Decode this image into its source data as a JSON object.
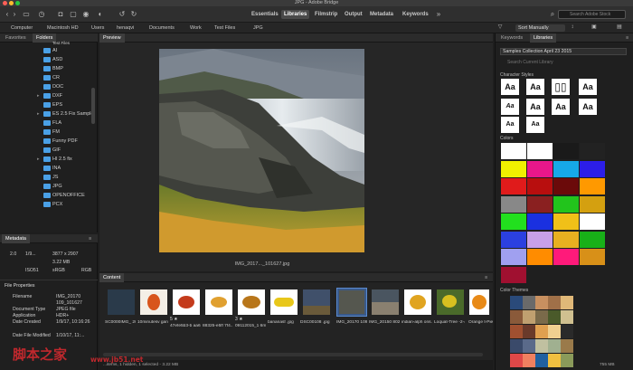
{
  "window": {
    "title": "JPG - Adobe Bridge"
  },
  "toolbar": {
    "workspaces": [
      "Essentials",
      "Libraries",
      "Filmstrip",
      "Output",
      "Metadata",
      "Keywords"
    ],
    "active_workspace": "Libraries",
    "stock_search_placeholder": "Search Adobe Stock"
  },
  "pathbar": {
    "crumbs": [
      "Computer",
      "Macintosh HD",
      "Users",
      "henaqvi",
      "Documents",
      "Work",
      "Test Files",
      "JPG"
    ],
    "sort": "Sort Manually"
  },
  "left_panel": {
    "tabs": [
      "Favorites",
      "Folders"
    ],
    "active_tab": "Folders",
    "folders": [
      "Test Files",
      "AI",
      "ASD",
      "BMP",
      "CR",
      "DOC",
      "DXF",
      "EPS",
      "ES 2.5 Fix Sample",
      "FLA",
      "FM",
      "Funny PDF",
      "GIF",
      "HI 2.5 fix",
      "INA",
      "JS",
      "JPG",
      "OPENOFFICE",
      "PCX"
    ]
  },
  "metadata": {
    "tab": "Metadata",
    "exposure": [
      "2.0",
      "1/9...",
      "3877 x 2907",
      "3.22 MB",
      "ISO51",
      "sRGB",
      "RGB"
    ],
    "section": "File Properties",
    "rows": [
      {
        "label": "Filename",
        "value": "IMG_20170 109_101627"
      },
      {
        "label": "Document Type",
        "value": "JPEG file"
      },
      {
        "label": "Application",
        "value": "HDR+"
      },
      {
        "label": "Date Created",
        "value": "1/9/17, 10:16:26"
      },
      {
        "label": "Date File Modified",
        "value": "1/10/17, 11:..."
      }
    ]
  },
  "preview": {
    "tab": "Preview",
    "filename": "IMG_2017..._101627.jpg"
  },
  "content": {
    "tab": "Content",
    "thumbs": [
      {
        "label": "SC0000IMG_ 2015_8..llR.jpg",
        "stars": "",
        "color": "#2a3a4a"
      },
      {
        "label": "10minutesv gan...81.jpg",
        "stars": "",
        "color": "#d8551c"
      },
      {
        "label": "47efe5b3-b aa6...89.jpg",
        "stars": "5 ★",
        "color": "#c43b1c"
      },
      {
        "label": "88325-e5ff 7f4...28.jpg",
        "stars": "",
        "color": "#e0a030"
      },
      {
        "label": "09112015_1 6mi...to.jpg",
        "stars": "3 ★",
        "color": "#b8761a"
      },
      {
        "label": "bananasf .jpg",
        "stars": "",
        "color": "#e8c71a"
      },
      {
        "label": "DSC00108 .jpg",
        "stars": "",
        "color": "#40506a"
      },
      {
        "label": "IMG_20170 109...27.jpg",
        "stars": "",
        "color": "#394a5c"
      },
      {
        "label": "IMG_20150 802...20.jpg",
        "stars": "",
        "color": "#4a5560"
      },
      {
        "label": "indian-alph ons...go.jpg",
        "stars": "",
        "color": "#e0a420"
      },
      {
        "label": "Loquat-Tree -2-460w.jpg",
        "stars": "",
        "color": "#d8c020"
      },
      {
        "label": "Orange t-Piece",
        "stars": "",
        "color": "#e88a18"
      }
    ],
    "status": "...items, 1 hidden, 1 selected - 3.22 MB"
  },
  "libraries": {
    "tabs": [
      "Keywords",
      "Libraries"
    ],
    "active_tab": "Libraries",
    "library": "Samples Collection April 23 2015",
    "search_placeholder": "Search Current Library",
    "styles_head": "Character Styles",
    "style_tiles": [
      "Aa",
      "Aa",
      "Aa",
      "Aa",
      "Aa",
      "Aa",
      "Aa",
      "Aa",
      "Aa",
      "Aa"
    ],
    "colors_head": "Colors",
    "colors": [
      "#ffffff",
      "#ffffff",
      "#1a1a1a",
      "#222222",
      "#f0f000",
      "#e8178a",
      "#16a8e8",
      "#2c1ee8",
      "#e01b1b",
      "#b80e0e",
      "#6b0a0a",
      "#ff9900",
      "#888888",
      "#8a2020",
      "#22c41c",
      "#d4a010",
      "#22e01e",
      "#1a30e0",
      "#f0c018",
      "#ffffff",
      "#2b40e0",
      "#c8a0e8",
      "#e8b020",
      "#18b018",
      "#a0a0f0",
      "#ff8c00",
      "#ff1a7a",
      "#d89018",
      "#a01030"
    ],
    "themes_head": "Color Themes",
    "themes": [
      "#2a4a7a",
      "#6a6a6a",
      "#c89060",
      "#a07048",
      "#e0b878",
      "#8a5a3a",
      "#c0a070",
      "#7a6a4a",
      "#4a5a2a",
      "#d0c090",
      "#a05030",
      "#6a3a2a",
      "#e0a050",
      "#f0d090",
      "#2a2a2a",
      "#3a4a6a",
      "#5a6a8a",
      "#c0c0a0",
      "#a0b090",
      "#9a7a4a",
      "#e04848",
      "#f08060",
      "#2060a0",
      "#f0c040",
      "#8a9a5a"
    ],
    "footer": "755 MB"
  },
  "watermark": {
    "text": "脚本之家",
    "url": "www.jb51.net"
  }
}
